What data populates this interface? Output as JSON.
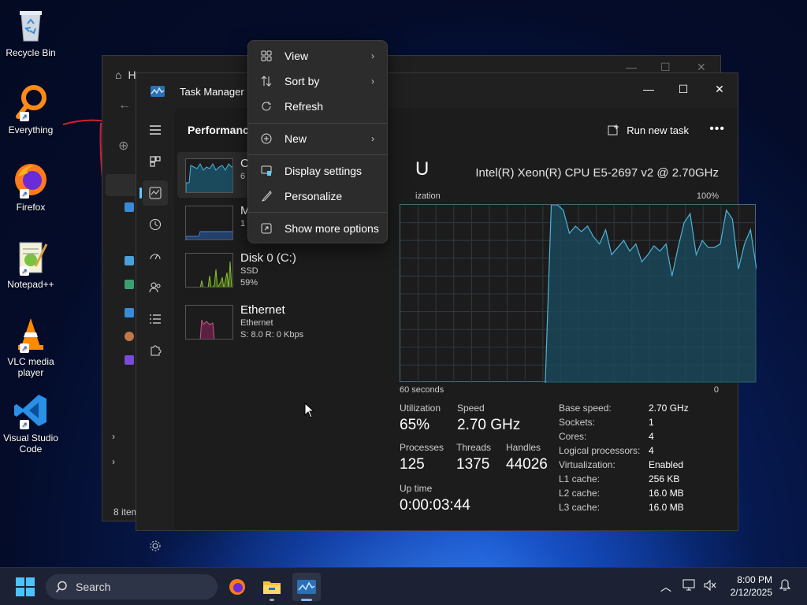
{
  "desktop": {
    "icons": [
      {
        "label": "Recycle Bin"
      },
      {
        "label": "Everything"
      },
      {
        "label": "Firefox"
      },
      {
        "label": "Notepad++"
      },
      {
        "label": "VLC media player"
      },
      {
        "label": "Visual Studio Code"
      }
    ]
  },
  "explorer": {
    "title": "H",
    "status": "8 item"
  },
  "task_manager": {
    "title": "Task Manager",
    "page_title": "Performance",
    "run_new_task": "Run new task",
    "more": "•••",
    "nav": [
      "menu",
      "processes",
      "performance",
      "app-history",
      "startup-apps",
      "users",
      "details",
      "services",
      "settings"
    ],
    "perf_list": [
      {
        "name": "C",
        "sub1": "6",
        "sub2": ""
      },
      {
        "name": "M",
        "sub1": "1",
        "sub2": ""
      },
      {
        "name": "Disk 0 (C:)",
        "sub1": "SSD",
        "sub2": "59%"
      },
      {
        "name": "Ethernet",
        "sub1": "Ethernet",
        "sub2": "S: 8.0  R: 0 Kbps"
      }
    ],
    "cpu": {
      "heading": "U",
      "model": "Intel(R) Xeon(R) CPU E5-2697 v2 @ 2.70GHz",
      "graph_label": "ization",
      "graph_max": "100%",
      "graph_time": "60 seconds",
      "graph_zero": "0",
      "graph_values": [
        0,
        0,
        0,
        0,
        0,
        0,
        0,
        0,
        0,
        0,
        0,
        0,
        0,
        0,
        0,
        0,
        0,
        0,
        0,
        0,
        0,
        0,
        0,
        0,
        0,
        100,
        100,
        97,
        84,
        88,
        85,
        88,
        82,
        78,
        86,
        72,
        76,
        80,
        74,
        78,
        68,
        72,
        77,
        74,
        78,
        60,
        76,
        90,
        95,
        72,
        80,
        76,
        76,
        78,
        97,
        92,
        64,
        78,
        86,
        64
      ],
      "stats": {
        "utilization_label": "Utilization",
        "utilization": "65%",
        "speed_label": "Speed",
        "speed": "2.70 GHz",
        "processes_label": "Processes",
        "processes": "125",
        "threads_label": "Threads",
        "threads": "1375",
        "handles_label": "Handles",
        "handles": "44026",
        "uptime_label": "Up time",
        "uptime": "0:00:03:44"
      },
      "specs": [
        {
          "label": "Base speed:",
          "value": "2.70 GHz"
        },
        {
          "label": "Sockets:",
          "value": "1"
        },
        {
          "label": "Cores:",
          "value": "4"
        },
        {
          "label": "Logical processors:",
          "value": "4"
        },
        {
          "label": "Virtualization:",
          "value": "Enabled"
        },
        {
          "label": "L1 cache:",
          "value": "256 KB"
        },
        {
          "label": "L2 cache:",
          "value": "16.0 MB"
        },
        {
          "label": "L3 cache:",
          "value": "16.0 MB"
        }
      ]
    }
  },
  "context_menu": {
    "items": [
      {
        "label": "View",
        "icon": "grid-icon",
        "submenu": true
      },
      {
        "label": "Sort by",
        "icon": "sort-icon",
        "submenu": true
      },
      {
        "label": "Refresh",
        "icon": "refresh-icon",
        "submenu": false
      },
      {
        "label": "New",
        "icon": "plus-circle-icon",
        "submenu": true
      },
      {
        "label": "Display settings",
        "icon": "display-icon",
        "submenu": false
      },
      {
        "label": "Personalize",
        "icon": "brush-icon",
        "submenu": false
      },
      {
        "label": "Show more options",
        "icon": "more-options-icon",
        "submenu": false
      }
    ]
  },
  "taskbar": {
    "search_placeholder": "Search",
    "time": "8:00 PM",
    "date": "2/12/2025"
  },
  "colors": {
    "accent": "#60cdff",
    "cpu_graph_line": "#4fb3d9",
    "cpu_graph_fill": "#1a4a5c",
    "memory_graph": "#4a7fd0",
    "disk_graph": "#8bbf2e",
    "ethernet_graph": "#c85a8a"
  }
}
